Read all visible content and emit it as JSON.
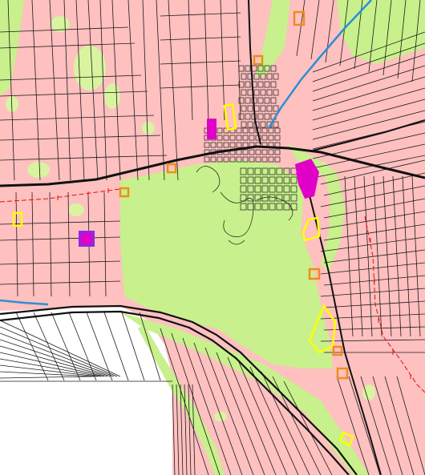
{
  "map": {
    "colors": {
      "agricultural_land": "#ffc0c0",
      "green_area": "#c8f08c",
      "green_patch": "#d8f4a0",
      "outside_area": "#ffffff",
      "parcel_line": "#1a1a1a",
      "road_casing": "#111111",
      "water": "#2a8fd8",
      "power_line": "#e01010",
      "commercial_zone": "#e000c8",
      "special_zone": "#8a2be2",
      "yellow_marker": "#ffff00",
      "orange_marker": "#f08c1e"
    },
    "layers": [
      "agricultural-land",
      "green-area",
      "built-up-center",
      "parcel-lines",
      "water-canal",
      "power-line",
      "highway",
      "zone-markers"
    ]
  }
}
